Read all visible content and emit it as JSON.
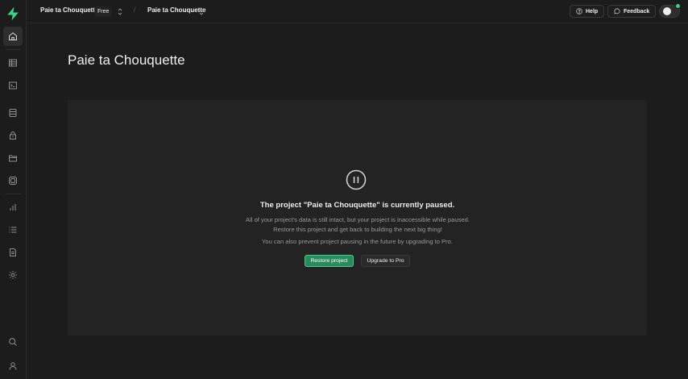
{
  "topbar": {
    "org_name": "Paie ta Chouquette",
    "plan_badge": "Free",
    "separator": "/",
    "project_name": "Paie ta Chouquette",
    "help_label": "Help",
    "feedback_label": "Feedback"
  },
  "sidebar": {
    "items": [
      {
        "name": "home",
        "icon": "home-icon",
        "active": true
      },
      {
        "name": "table-editor",
        "icon": "table-icon"
      },
      {
        "name": "sql-editor",
        "icon": "terminal-icon"
      },
      {
        "name": "database",
        "icon": "database-icon"
      },
      {
        "name": "authentication",
        "icon": "lock-icon"
      },
      {
        "name": "storage",
        "icon": "folder-icon"
      },
      {
        "name": "edge-functions",
        "icon": "functions-icon"
      },
      {
        "name": "reports",
        "icon": "bar-chart-icon"
      },
      {
        "name": "logs",
        "icon": "list-icon"
      },
      {
        "name": "api-docs",
        "icon": "document-icon"
      },
      {
        "name": "settings",
        "icon": "gear-icon"
      },
      {
        "name": "search",
        "icon": "search-icon"
      },
      {
        "name": "account",
        "icon": "user-icon"
      }
    ]
  },
  "main": {
    "page_title": "Paie ta Chouquette",
    "paused_title": "The project \"Paie ta Chouquette\" is currently paused.",
    "paused_description": "All of your project's data is still intact, but your project is inaccessible while paused. Restore this project and get back to building the next big thing!",
    "paused_hint": "You can also prevent project pausing in the future by upgrading to Pro.",
    "restore_label": "Restore project",
    "upgrade_label": "Upgrade to Pro"
  },
  "colors": {
    "background": "#1c1c1c",
    "panel": "#232323",
    "accent_green": "#3ecf8e",
    "restore_button": "#2a8a5e"
  }
}
